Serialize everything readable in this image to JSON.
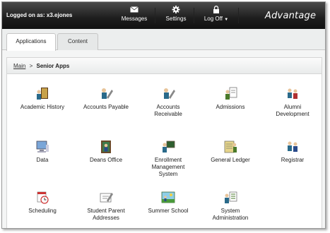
{
  "header": {
    "logon_prefix": "Logged on as:",
    "username": "x3.ejones",
    "nav": [
      {
        "label": "Messages",
        "icon": "envelope-icon"
      },
      {
        "label": "Settings",
        "icon": "gear-icon"
      },
      {
        "label": "Log Off",
        "icon": "lock-icon"
      }
    ],
    "logo_text": "Advantage"
  },
  "tabs": [
    {
      "label": "Applications",
      "active": true
    },
    {
      "label": "Content",
      "active": false
    }
  ],
  "breadcrumb": {
    "root": "Main",
    "separator": ">",
    "current": "Senior Apps"
  },
  "apps": [
    {
      "label": "Academic History",
      "icon": "book-person-icon"
    },
    {
      "label": "Accounts Payable",
      "icon": "person-pen-icon"
    },
    {
      "label": "Accounts Receivable",
      "icon": "person-pen-icon"
    },
    {
      "label": "Admissions",
      "icon": "person-document-icon"
    },
    {
      "label": "Alumni Development",
      "icon": "people-icon"
    },
    {
      "label": "Data",
      "icon": "computer-icon"
    },
    {
      "label": "Deans Office",
      "icon": "office-door-icon"
    },
    {
      "label": "Enrollment Management System",
      "icon": "board-person-icon"
    },
    {
      "label": "General Ledger",
      "icon": "ledger-icon"
    },
    {
      "label": "Registrar",
      "icon": "people-icon"
    },
    {
      "label": "Scheduling",
      "icon": "clock-calendar-icon"
    },
    {
      "label": "Student Parent Addresses",
      "icon": "address-card-icon"
    },
    {
      "label": "Summer School",
      "icon": "school-scene-icon"
    },
    {
      "label": "System Administration",
      "icon": "admin-person-icon"
    }
  ],
  "colors": {
    "header_bg": "#1d1d1d",
    "panel_bg": "#ffffff",
    "accent_green": "#4a7a2a"
  }
}
